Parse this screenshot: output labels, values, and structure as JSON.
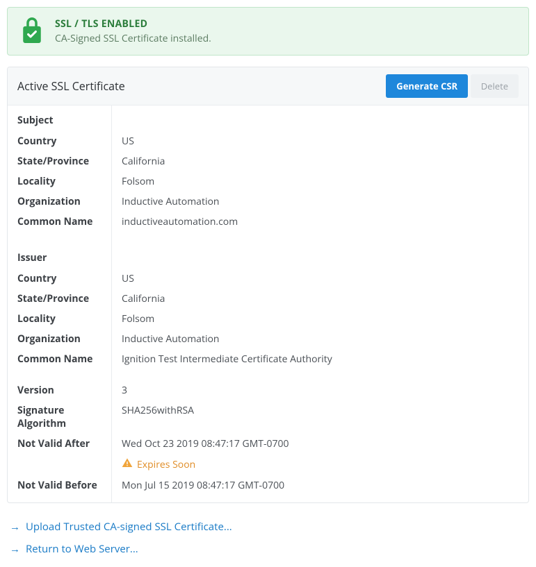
{
  "banner": {
    "title": "SSL / TLS ENABLED",
    "subtitle": "CA-Signed SSL Certificate installed."
  },
  "card": {
    "title": "Active SSL Certificate",
    "btn_generate": "Generate CSR",
    "btn_delete": "Delete"
  },
  "sections": {
    "subject_head": "Subject",
    "issuer_head": "Issuer"
  },
  "labels": {
    "country": "Country",
    "state": "State/Province",
    "locality": "Locality",
    "organization": "Organization",
    "common_name": "Common Name",
    "version": "Version",
    "sig_alg": "Signature Algorithm",
    "not_after": "Not Valid After",
    "not_before": "Not Valid Before"
  },
  "subject": {
    "country": "US",
    "state": "California",
    "locality": "Folsom",
    "organization": "Inductive Automation",
    "common_name": "inductiveautomation.com"
  },
  "issuer": {
    "country": "US",
    "state": "California",
    "locality": "Folsom",
    "organization": "Inductive Automation",
    "common_name": "Ignition Test Intermediate Certificate Authority"
  },
  "cert": {
    "version": "3",
    "sig_alg": "SHA256withRSA",
    "not_after": "Wed Oct 23 2019 08:47:17 GMT-0700",
    "not_before": "Mon Jul 15 2019 08:47:17 GMT-0700",
    "expires_soon": "Expires Soon"
  },
  "actions": {
    "upload": "Upload Trusted CA-signed SSL Certificate...",
    "return": "Return to Web Server..."
  }
}
